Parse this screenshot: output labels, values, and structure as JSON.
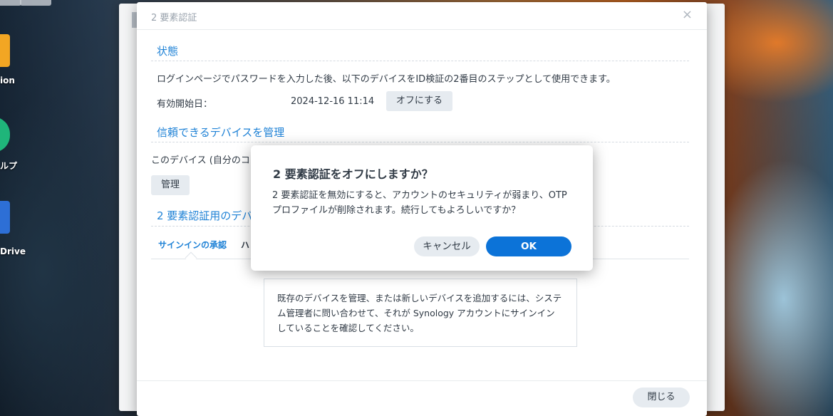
{
  "desktop": {
    "icons": [
      {
        "name": "folder",
        "label": "ion",
        "color": "#f2a623"
      },
      {
        "name": "help",
        "label": "ルプ",
        "color": "#1fb57a"
      },
      {
        "name": "drive",
        "label": "Drive",
        "color": "#2d6fd6"
      }
    ]
  },
  "dialog": {
    "title": "2 要素認証",
    "close_icon": "×",
    "status": {
      "heading": "状態",
      "description": "ログインページでパスワードを入力した後、以下のデバイスをID検証の2番目のステップとして使用できます。",
      "enabled_label": "有効開始日：",
      "enabled_date": "2024-12-16 11:14",
      "turn_off_label": "オフにする"
    },
    "trusted": {
      "heading": "信頼できるデバイスを管理",
      "text": "このデバイス (自分のコ",
      "manage_label": "管理"
    },
    "devices": {
      "heading": "2 要素認証用のデバ",
      "tabs": [
        {
          "label": "サインインの承認",
          "active": true
        },
        {
          "label": "ハ",
          "active": false
        }
      ],
      "info": "既存のデバイスを管理、または新しいデバイスを追加するには、システム管理者に問い合わせて、それが Synology アカウントにサインインしていることを確認してください。"
    },
    "close_label": "閉じる"
  },
  "confirm": {
    "title": "2 要素認証をオフにしますか？",
    "message": "2 要素認証を無効にすると、アカウントのセキュリティが弱まり、OTP プロファイルが削除されます。続行してもよろしいですか？",
    "cancel_label": "キャンセル",
    "ok_label": "OK"
  },
  "colors": {
    "accent": "#1f82d6",
    "primary_button": "#0c73d8"
  }
}
